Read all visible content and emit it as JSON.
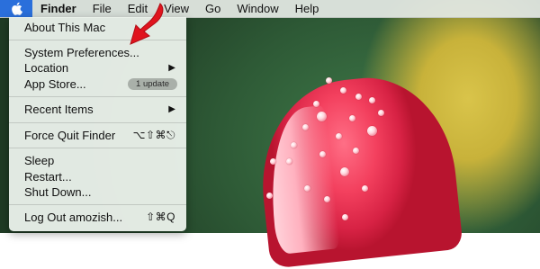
{
  "menubar": {
    "apple_icon": "apple-logo-icon",
    "items": [
      "Finder",
      "File",
      "Edit",
      "View",
      "Go",
      "Window",
      "Help"
    ]
  },
  "apple_menu": {
    "about": "About This Mac",
    "system_prefs": "System Preferences...",
    "location": "Location",
    "app_store": "App Store...",
    "app_store_badge": "1 update",
    "recent_items": "Recent Items",
    "force_quit": "Force Quit Finder",
    "force_quit_shortcut": "⌥⇧⌘⎋",
    "sleep": "Sleep",
    "restart": "Restart...",
    "shut_down": "Shut Down...",
    "log_out": "Log Out amozish...",
    "log_out_shortcut": "⇧⌘Q",
    "submenu_icon": "submenu-arrow-icon"
  },
  "colors": {
    "highlight": "#2a6fdb",
    "annotation_arrow": "#e0141e"
  }
}
